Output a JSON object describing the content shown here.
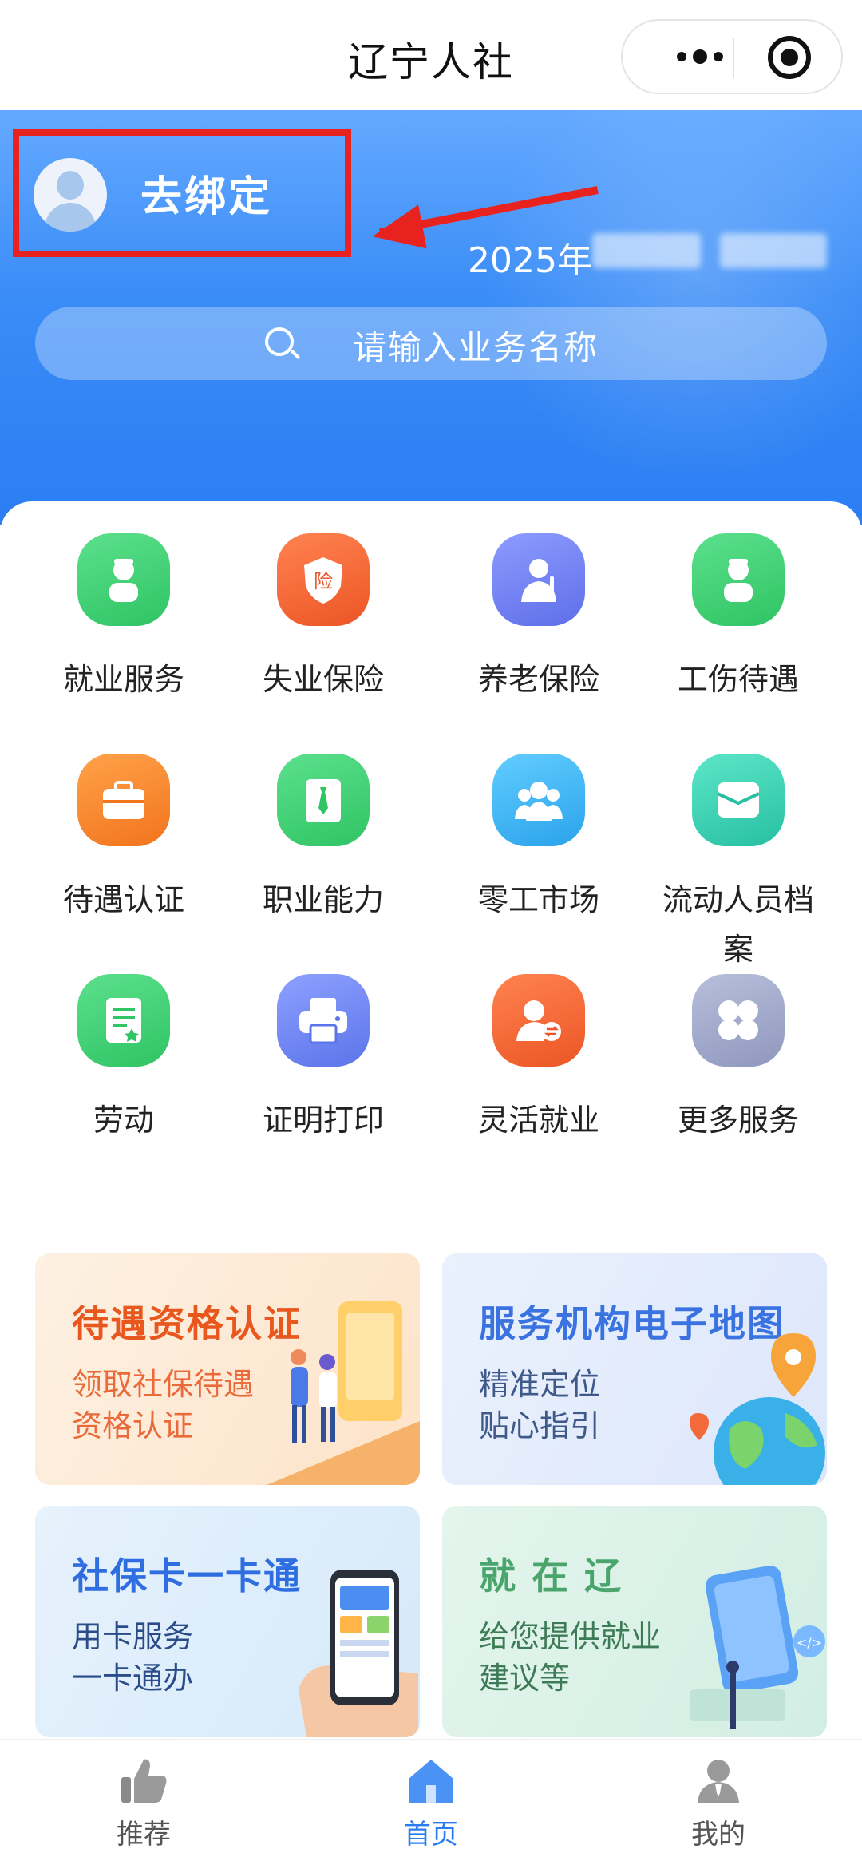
{
  "header": {
    "title": "辽宁人社"
  },
  "hero": {
    "bind_label": "去绑定",
    "date_prefix": "2025年",
    "search_placeholder": "请输入业务名称"
  },
  "services": [
    {
      "label": "就业服务",
      "icon": "employment-service-icon",
      "color": "#3ecf73"
    },
    {
      "label": "失业保险",
      "icon": "unemployment-insurance-icon",
      "color": "#f0652c"
    },
    {
      "label": "养老保险",
      "icon": "pension-insurance-icon",
      "color": "#6b7cf0"
    },
    {
      "label": "工伤待遇",
      "icon": "work-injury-icon",
      "color": "#3ecf73"
    },
    {
      "label": "待遇认证",
      "icon": "briefcase-icon",
      "color": "#f6882a"
    },
    {
      "label": "职业能力",
      "icon": "tie-icon",
      "color": "#3ecf73"
    },
    {
      "label": "零工市场",
      "icon": "group-icon",
      "color": "#38b6f0"
    },
    {
      "label": "流动人员档案",
      "icon": "folder-icon",
      "color": "#33d1b4"
    },
    {
      "label": "劳动",
      "icon": "document-icon",
      "color": "#3ecf73"
    },
    {
      "label": "证明打印",
      "icon": "printer-icon",
      "color": "#6b85f0"
    },
    {
      "label": "灵活就业",
      "icon": "flexible-employment-icon",
      "color": "#f0652c"
    },
    {
      "label": "更多服务",
      "icon": "more-services-icon",
      "color": "#9ea7c8"
    }
  ],
  "banners": [
    {
      "title": "待遇资格认证",
      "subtitle": "领取社保待遇\n资格认证",
      "title_color": "#e8571d",
      "sub_color": "#ea6a3a",
      "bg": "#fdeedd"
    },
    {
      "title": "服务机构电子地图",
      "subtitle": "精准定位\n贴心指引",
      "title_color": "#3a73e0",
      "sub_color": "#3f5a8a",
      "bg": "#e5edfb"
    },
    {
      "title": "社保卡一卡通",
      "subtitle": "用卡服务\n一卡通办",
      "title_color": "#2f6ee0",
      "sub_color": "#2a4d8a",
      "bg": "#e3f0fb"
    },
    {
      "title": "就 在 辽",
      "subtitle": "给您提供就业\n建议等",
      "title_color": "#4aa56d",
      "sub_color": "#3d7a56",
      "bg": "#e1f3ea"
    }
  ],
  "tabbar": [
    {
      "label": "推荐",
      "icon": "thumbs-up-icon"
    },
    {
      "label": "首页",
      "icon": "home-icon"
    },
    {
      "label": "我的",
      "icon": "user-icon"
    }
  ],
  "colors": {
    "accent": "#2a7cf2",
    "highlight_box": "#e8231f"
  }
}
